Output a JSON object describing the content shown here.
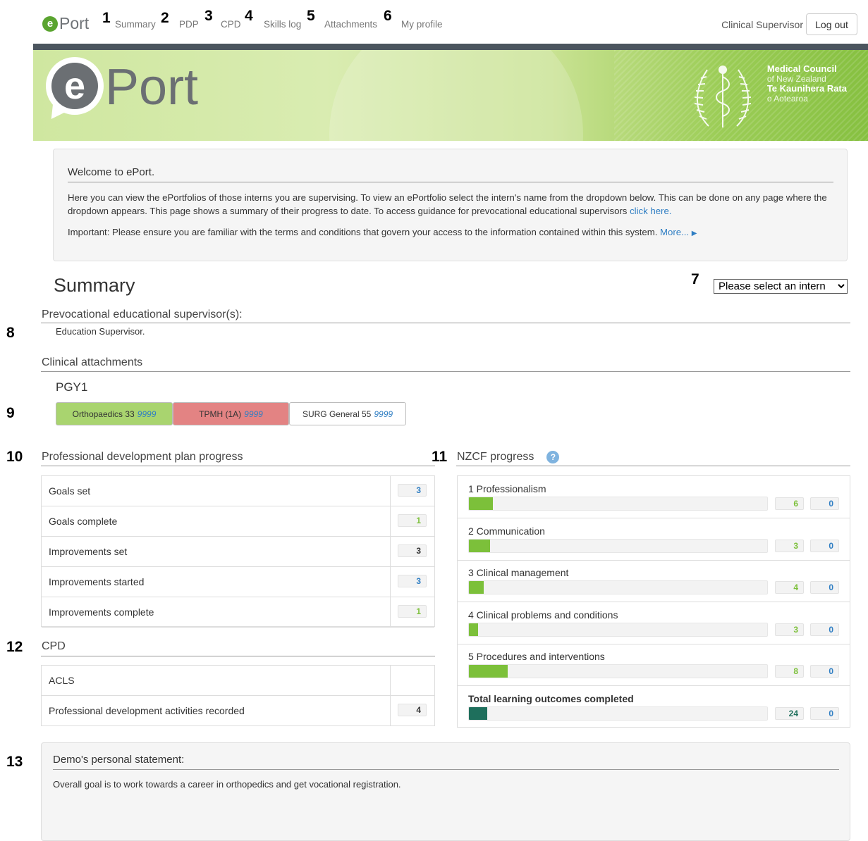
{
  "nav": {
    "brand": "Port",
    "links": [
      {
        "num": "1",
        "label": "Summary"
      },
      {
        "num": "2",
        "label": "PDP"
      },
      {
        "num": "3",
        "label": "CPD"
      },
      {
        "num": "4",
        "label": "Skills log"
      },
      {
        "num": "5",
        "label": "Attachments"
      },
      {
        "num": "6",
        "label": "My profile"
      }
    ],
    "user": "Clinical Supervisor",
    "logout": "Log out"
  },
  "banner": {
    "logo_text": "Port",
    "mcnz_line1": "Medical Council",
    "mcnz_line2": "of New Zealand",
    "mcnz_line3": "Te Kaunihera Rata",
    "mcnz_line4": "o Aotearoa"
  },
  "welcome": {
    "title": "Welcome to ePort.",
    "para1": "Here you can view the ePortfolios of those interns you are supervising. To view an ePortfolio select the intern's name from the dropdown below. This can be done on any page where the dropdown appears. This page shows a summary of their progress to date. To access guidance for prevocational educational supervisors",
    "para1_link": "click here.",
    "para2": "Important: Please ensure you are familiar with the terms and conditions that govern your access to the information contained within this system.",
    "para2_link": "More..."
  },
  "callouts": {
    "c7": "7",
    "c8": "8",
    "c9": "9",
    "c10": "10",
    "c11": "11",
    "c12": "12",
    "c13": "13"
  },
  "summary": {
    "title": "Summary",
    "intern_select": "Please select an intern",
    "supervisor_heading": "Prevocational educational supervisor(s):",
    "supervisor_name": "Education Supervisor.",
    "attachments_heading": "Clinical attachments",
    "pgy": "PGY1",
    "attachments": [
      {
        "name": "Orthopaedics 33",
        "code": "9999",
        "color": "#a9d46f"
      },
      {
        "name": "TPMH (1A)",
        "code": "9999",
        "color": "#e38383"
      },
      {
        "name": "SURG General 55",
        "code": "9999",
        "color": "#ffffff"
      }
    ]
  },
  "pdp": {
    "heading": "Professional development plan progress",
    "rows": [
      {
        "label": "Goals set",
        "value": "3",
        "color": "#2f7ec3"
      },
      {
        "label": "Goals complete",
        "value": "1",
        "color": "#7cc03a"
      },
      {
        "label": "Improvements set",
        "value": "3",
        "color": "#333333"
      },
      {
        "label": "Improvements started",
        "value": "3",
        "color": "#2f7ec3"
      },
      {
        "label": "Improvements complete",
        "value": "1",
        "color": "#7cc03a"
      }
    ]
  },
  "cpd": {
    "heading": "CPD",
    "rows": [
      {
        "label": "ACLS",
        "value": ""
      },
      {
        "label": "Professional development activities recorded",
        "value": "4"
      }
    ]
  },
  "nzcf": {
    "heading": "NZCF progress",
    "help_glyph": "?",
    "items": [
      {
        "name": "1 Professionalism",
        "completed": "6",
        "pending": "0",
        "progress": 0.08
      },
      {
        "name": "2 Communication",
        "completed": "3",
        "pending": "0",
        "progress": 0.07
      },
      {
        "name": "3 Clinical management",
        "completed": "4",
        "pending": "0",
        "progress": 0.05
      },
      {
        "name": "4 Clinical problems and conditions",
        "completed": "3",
        "pending": "0",
        "progress": 0.03
      },
      {
        "name": "5 Procedures and interventions",
        "completed": "8",
        "pending": "0",
        "progress": 0.13
      },
      {
        "name": "Total learning outcomes completed",
        "completed": "24",
        "pending": "0",
        "progress": 0.06,
        "total": true
      }
    ]
  },
  "statement": {
    "heading": "Demo's personal statement:",
    "text": "Overall goal is to work towards a career in orthopedics and get vocational registration."
  },
  "colors": {
    "accent_green": "#7cc03a",
    "total_fill": "#1e6f5c",
    "link_blue": "#2f7ec3",
    "banner_stripe": "#4b555e"
  }
}
